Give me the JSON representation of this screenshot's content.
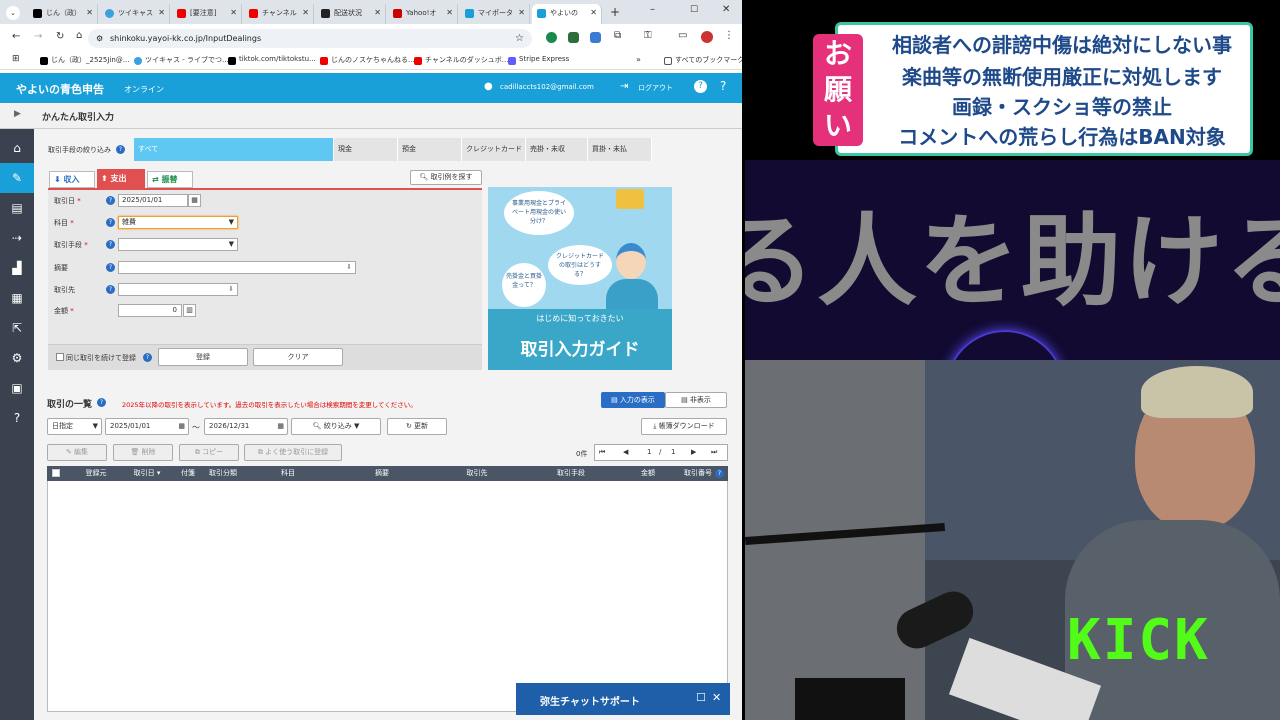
{
  "browser": {
    "tabs": [
      {
        "label": "じん（政）"
      },
      {
        "label": "ツイキャス"
      },
      {
        "label": "[要注意]"
      },
      {
        "label": "チャンネル"
      },
      {
        "label": "配送状況"
      },
      {
        "label": "Yahoo!オ"
      },
      {
        "label": "マイポータ"
      },
      {
        "label": "やよいの"
      }
    ],
    "url": "shinkoku.yayoi-kk.co.jp/InputDealings",
    "bookmarks": [
      {
        "label": "じん（政）_2525Jin@..."
      },
      {
        "label": "ツイキャス - ライブでつ..."
      },
      {
        "label": "tiktok.com/tiktokstu..."
      },
      {
        "label": "じんのノスケちゃんねる..."
      },
      {
        "label": "チャンネルのダッシュボ..."
      },
      {
        "label": "Stripe Express"
      }
    ],
    "all_bookmarks": "すべてのブックマーク"
  },
  "app": {
    "logo": "やよいの青色申告",
    "logo_sub": "オンライン",
    "email": "cadillaccts102@gmail.com",
    "logout": "ログアウト",
    "page_title": "かんたん取引入力"
  },
  "filter": {
    "label": "取引手段の絞り込み",
    "options": [
      "すべて",
      "現金",
      "預金",
      "クレジットカード",
      "売掛・未収",
      "買掛・未払"
    ]
  },
  "form": {
    "tabs": [
      "収入",
      "支出",
      "振替"
    ],
    "find_example": "取引例を探す",
    "date_label": "取引日",
    "date_value": "2025/01/01",
    "account_label": "科目",
    "account_value": "雑費",
    "method_label": "取引手段",
    "summary_label": "摘要",
    "partner_label": "取引先",
    "amount_label": "金額",
    "amount_value": "0",
    "continue_label": "同じ取引を続けて登録",
    "register_button": "登録",
    "clear_button": "クリア"
  },
  "guide": {
    "bubble1": "事業用現金とプライベート用現金の使い分け？",
    "bubble2": "クレジットカードの取引はどうする？",
    "bubble3": "売掛金と買掛金って？",
    "sub": "はじめに知っておきたい",
    "title": "取引入力ガイド"
  },
  "list": {
    "title": "取引の一覧",
    "notice": "2025年以降の取引を表示しています。過去の取引を表示したい場合は検索期間を変更してください。",
    "show_input": "入力の表示",
    "hide": "非表示",
    "period_type": "日指定",
    "from": "2025/01/01",
    "tilde": "～",
    "to": "2026/12/31",
    "narrow": "絞り込み",
    "refresh": "更新",
    "download": "帳簿ダウンロード",
    "edit": "編集",
    "delete": "削除",
    "copy": "コピー",
    "frequent": "よく使う取引に登録",
    "count": "0件",
    "page": "1",
    "slash": "/",
    "pages": "1",
    "columns": [
      "登録元",
      "取引日 ▾",
      "付箋",
      "取引分類",
      "科目",
      "摘要",
      "取引先",
      "取引手段",
      "金額",
      "取引番号"
    ]
  },
  "chat": {
    "label": "弥生チャットサポート"
  },
  "stream": {
    "onegai": "お願い",
    "notices": [
      "相談者への誹謗中傷は絶対にしない事",
      "楽曲等の無断使用厳正に対処します",
      "画録・スクショ等の禁止",
      "コメントへの荒らし行為はBAN対象"
    ],
    "big_text": "る人を助ける",
    "kick": "KICK"
  },
  "colors": {
    "accent": "#1aa0d8",
    "sidebar": "#39424e",
    "kick": "#53fc18",
    "notice_border": "#3ac7a3",
    "onegai": "#e5307a"
  }
}
